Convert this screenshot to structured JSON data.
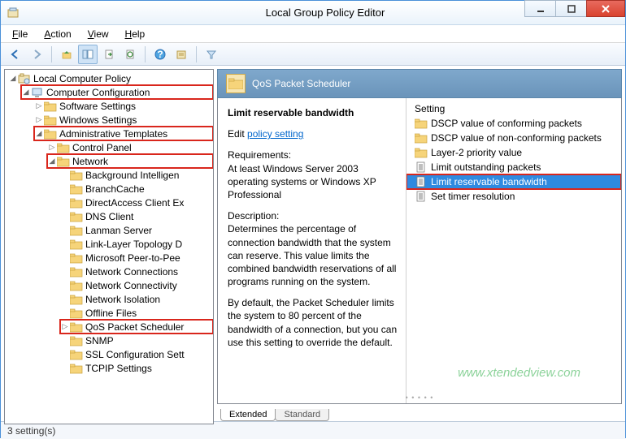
{
  "window": {
    "title": "Local Group Policy Editor"
  },
  "menu": {
    "file": "File",
    "action": "Action",
    "view": "View",
    "help": "Help"
  },
  "toolbar_icons": [
    "back",
    "forward",
    "up",
    "list",
    "export",
    "refresh",
    "help",
    "properties",
    "filter"
  ],
  "tree": {
    "root": "Local Computer Policy",
    "computer_config": "Computer Configuration",
    "software_settings": "Software Settings",
    "windows_settings": "Windows Settings",
    "admin_templates": "Administrative Templates",
    "control_panel": "Control Panel",
    "network": "Network",
    "network_children": [
      "Background Intelligen",
      "BranchCache",
      "DirectAccess Client Ex",
      "DNS Client",
      "Lanman Server",
      "Link-Layer Topology D",
      "Microsoft Peer-to-Pee",
      "Network Connections",
      "Network Connectivity",
      "Network Isolation",
      "Offline Files",
      "QoS Packet Scheduler",
      "SNMP",
      "SSL Configuration Sett",
      "TCPIP Settings"
    ],
    "qos_index": 11
  },
  "header": {
    "title": "QoS Packet Scheduler"
  },
  "description": {
    "title": "Limit reservable bandwidth",
    "edit_prefix": "Edit ",
    "edit_link": "policy setting",
    "req_label": "Requirements:",
    "req_text": "At least Windows Server 2003 operating systems or Windows XP Professional",
    "desc_label": "Description:",
    "desc_text1": "Determines the percentage of connection bandwidth that the system can reserve. This value limits the combined bandwidth reservations of all programs running on the system.",
    "desc_text2": "By default, the Packet Scheduler limits the system to 80 percent of the bandwidth of a connection, but you can use this setting to override the default."
  },
  "settings": {
    "header": "Setting",
    "items": [
      {
        "type": "folder",
        "label": "DSCP value of conforming packets"
      },
      {
        "type": "folder",
        "label": "DSCP value of non-conforming packets"
      },
      {
        "type": "folder",
        "label": "Layer-2 priority value"
      },
      {
        "type": "policy",
        "label": "Limit outstanding packets"
      },
      {
        "type": "policy",
        "label": "Limit reservable bandwidth",
        "selected": true,
        "highlight": true
      },
      {
        "type": "policy",
        "label": "Set timer resolution"
      }
    ]
  },
  "tabs": {
    "extended": "Extended",
    "standard": "Standard"
  },
  "status": "3 setting(s)",
  "watermark": "www.xtendedview.com"
}
